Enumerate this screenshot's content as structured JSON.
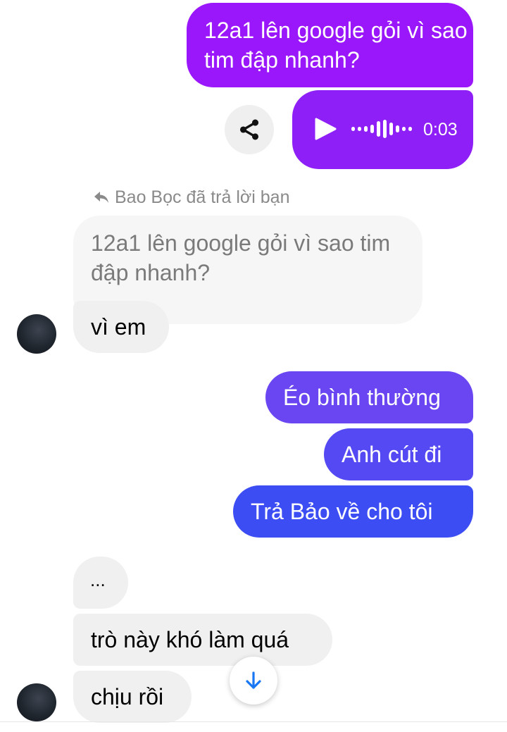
{
  "messages": {
    "outgoing_1": "12a1 lên google gỏi vì sao tim đập nhanh?",
    "voice_duration": "0:03",
    "reply_header": "Bao Bọc đã trả lời bạn",
    "quoted_text": "12a1 lên google gỏi vì sao tim đập nhanh?",
    "reply_text": "vì em",
    "outgoing_2": "Éo bình thường",
    "outgoing_3": "Anh cút đi",
    "outgoing_4": "Trả Bảo về cho tôi",
    "incoming_1": "...",
    "incoming_2": "trò này khó làm quá",
    "incoming_3": "chịu rồi"
  },
  "icons": {
    "share": "share-icon",
    "play": "play-icon",
    "waveform": "waveform-icon",
    "reply": "reply-icon",
    "scroll_down": "arrow-down-icon"
  },
  "colors": {
    "outgoing_purple": "#9a16fb",
    "outgoing_blue": "#3d4df4",
    "incoming_gray": "#f0f0f0",
    "accent_arrow": "#1877f2"
  }
}
